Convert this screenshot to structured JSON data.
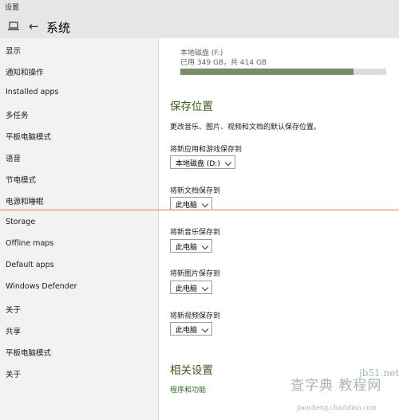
{
  "app": {
    "title": "设置"
  },
  "header": {
    "title": "系统",
    "back_icon": "arrow-left",
    "pc_icon": "laptop"
  },
  "sidebar": {
    "items": [
      {
        "label": "显示"
      },
      {
        "label": "通知和操作"
      },
      {
        "label": "Installed apps"
      },
      {
        "label": "多任务"
      },
      {
        "label": "平板电脑模式"
      },
      {
        "label": "语音"
      },
      {
        "label": "节电模式"
      },
      {
        "label": "电源和睡眠"
      },
      {
        "label": "Storage"
      },
      {
        "label": "Offline maps"
      },
      {
        "label": "Default apps"
      },
      {
        "label": "Windows Defender"
      },
      {
        "label": "关于"
      },
      {
        "label": "共享"
      },
      {
        "label": "平板电脑模式"
      },
      {
        "label": "关于"
      }
    ]
  },
  "main": {
    "disk": {
      "label": "本地磁盘 (F:)",
      "usage": "已用 349 GB，共 414 GB",
      "used_fraction": 0.843
    },
    "save_section": {
      "title": "保存位置",
      "description": "更改音乐、图片、视频和文档的默认保存位置。",
      "fields": [
        {
          "label": "将新应用和游戏保存到",
          "value": "本地磁盘 (D:)"
        },
        {
          "label": "将新文档保存到",
          "value": "此电脑"
        },
        {
          "label": "将新音乐保存到",
          "value": "此电脑"
        },
        {
          "label": "将新图片保存到",
          "value": "此电脑"
        },
        {
          "label": "将新视频保存到",
          "value": "此电脑"
        }
      ]
    },
    "related_section": {
      "title": "相关设置",
      "link": "程序和功能"
    }
  },
  "watermark": {
    "big": "查字典 教程网",
    "url": "jb51.net",
    "small": "jiaocheng.chazidian.com"
  },
  "colors": {
    "accent_green": "#3c5a1e",
    "disk_bar_fill": "#7a8c6a",
    "divider_red": "#d9785a",
    "sidebar_bg": "#f2f2f2",
    "titlebar_bg": "#e6e6e6"
  }
}
